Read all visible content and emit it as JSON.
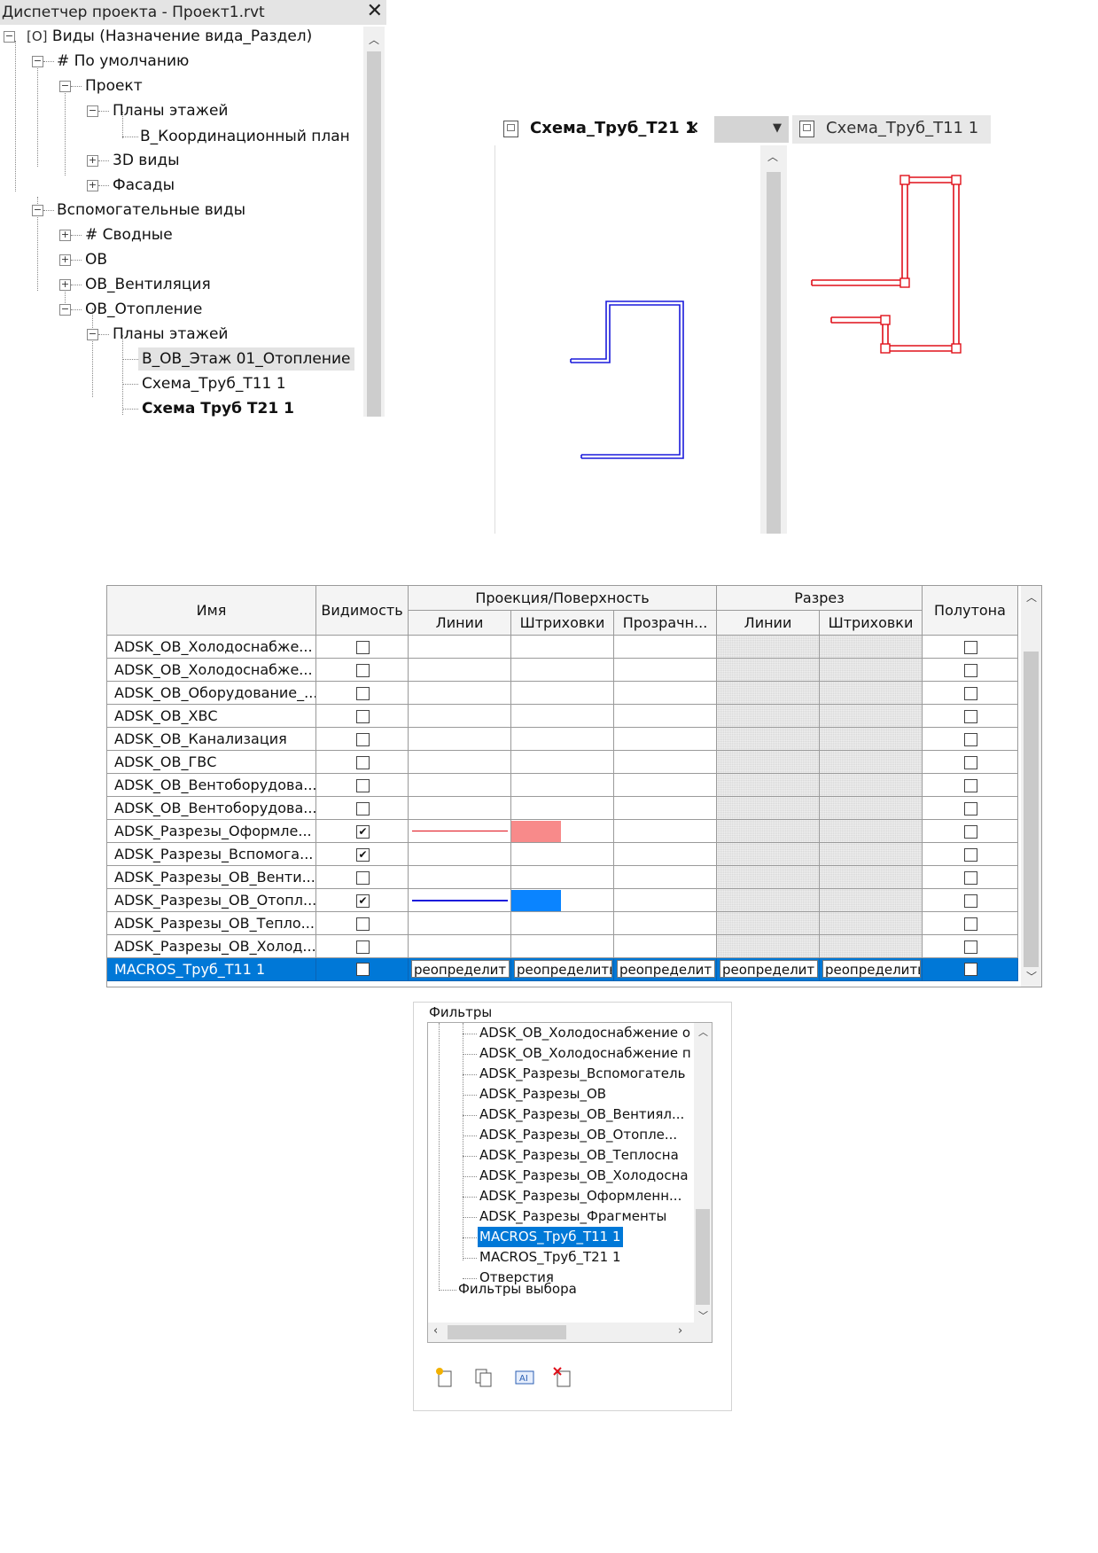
{
  "browser": {
    "title": "Диспетчер проекта - Проект1.rvt",
    "close_glyph": "✕",
    "nodes": [
      "Виды (Назначение вида_Раздел)",
      "# По умолчанию",
      "Проект",
      "Планы этажей",
      "В_Координационный план",
      "3D виды",
      "Фасады",
      "Вспомогательные виды",
      "# Сводные",
      "ОВ",
      "ОВ_Вентиляция",
      "ОВ_Отопление",
      "Планы этажей",
      "В_ОВ_Этаж 01_Отопление",
      "Схема_Труб_Т11 1",
      "Схема Труб Т21 1"
    ]
  },
  "tabs": {
    "active_label": "Схема_Труб_Т21 1",
    "active_close": "✕",
    "dropdown_glyph": "▼",
    "inactive_label": "Схема_Труб_Т11 1"
  },
  "colors": {
    "blue_pipe": "#1a1adb",
    "red_pipe": "#e0101a",
    "selection": "#0078d7",
    "pink_fill": "#f88a8a",
    "blue_fill": "#0a84ff"
  },
  "grid": {
    "headers": {
      "name": "Имя",
      "visibility": "Видимость",
      "projection": "Проекция/Поверхность",
      "cut": "Разрез",
      "halftone": "Полутона",
      "proj_lines": "Линии",
      "proj_patterns": "Штриховки",
      "proj_transparency": "Прозрачн...",
      "cut_lines": "Линии",
      "cut_patterns": "Штриховки"
    },
    "rows": [
      {
        "name": "ADSK_ОВ_Холодоснабже...",
        "visible": ""
      },
      {
        "name": "ADSK_ОВ_Холодоснабже...",
        "visible": ""
      },
      {
        "name": "ADSK_ОВ_Оборудование_...",
        "visible": ""
      },
      {
        "name": "ADSK_ОВ_ХВС",
        "visible": ""
      },
      {
        "name": "ADSK_ОВ_Канализация",
        "visible": ""
      },
      {
        "name": "ADSK_ОВ_ГВС",
        "visible": ""
      },
      {
        "name": "ADSK_ОВ_Вентоборудова...",
        "visible": ""
      },
      {
        "name": "ADSK_ОВ_Вентоборудова...",
        "visible": ""
      },
      {
        "name": "ADSK_Разрезы_Оформле...",
        "visible": "✔"
      },
      {
        "name": "ADSK_Разрезы_Вспомога...",
        "visible": "✔"
      },
      {
        "name": "ADSK_Разрезы_ОВ_Венти...",
        "visible": ""
      },
      {
        "name": "ADSK_Разрезы_ОВ_Отопл...",
        "visible": "✔"
      },
      {
        "name": "ADSK_Разрезы_ОВ_Тепло...",
        "visible": ""
      },
      {
        "name": "ADSK_Разрезы_ОВ_Холод...",
        "visible": ""
      }
    ],
    "selected": {
      "name": "MACROS_Труб_Т11 1",
      "override": [
        "реопределит",
        "реопределить",
        "реопределит",
        "реопределит",
        "реопределить"
      ]
    }
  },
  "filters": {
    "group_label": "Фильтры",
    "items": [
      "ADSK_ОВ_Холодоснабжение о",
      "ADSK_ОВ_Холодоснабжение п",
      "ADSK_Разрезы_Вспомогатель",
      "ADSK_Разрезы_ОВ",
      "ADSK_Разрезы_ОВ_Вентиял...",
      "ADSK_Разрезы_ОВ_Отопле...",
      "ADSK_Разрезы_ОВ_Теплосна",
      "ADSK_Разрезы_ОВ_Холодосна",
      "ADSK_Разрезы_Оформленн...",
      "ADSK_Разрезы_Фрагменты",
      "MACROS_Труб_Т11 1",
      "MACROS_Труб_Т21 1",
      "Отверстия"
    ],
    "selection_filters": "Фильтры выбора"
  }
}
